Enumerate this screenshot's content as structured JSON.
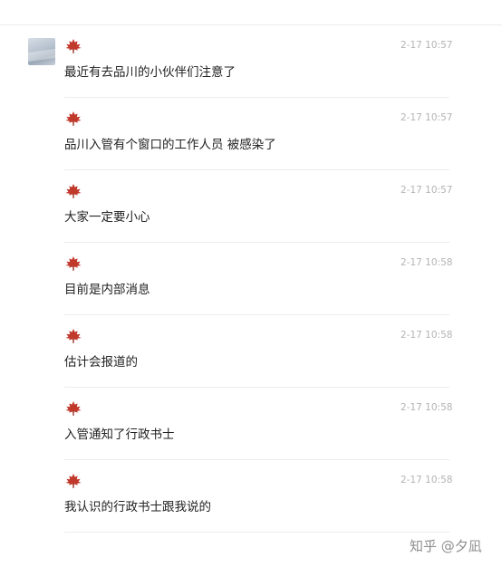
{
  "messages": [
    {
      "time": "2-17 10:57",
      "text": "最近有去品川的小伙伴们注意了"
    },
    {
      "time": "2-17 10:57",
      "text": "品川入管有个窗口的工作人员 被感染了"
    },
    {
      "time": "2-17 10:57",
      "text": "大家一定要小心"
    },
    {
      "time": "2-17 10:58",
      "text": "目前是内部消息"
    },
    {
      "time": "2-17 10:58",
      "text": "估计会报道的"
    },
    {
      "time": "2-17 10:58",
      "text": "入管通知了行政书士"
    },
    {
      "time": "2-17 10:58",
      "text": "我认识的行政书士跟我说的"
    }
  ],
  "watermark": "知乎 @夕凪",
  "colors": {
    "leaf": "#c0392b",
    "timestamp": "#b3b3b3",
    "text": "#222222",
    "divider": "#ececec"
  },
  "icons": {
    "sender_badge": "maple-leaf-icon",
    "avatar": "avatar-image"
  }
}
